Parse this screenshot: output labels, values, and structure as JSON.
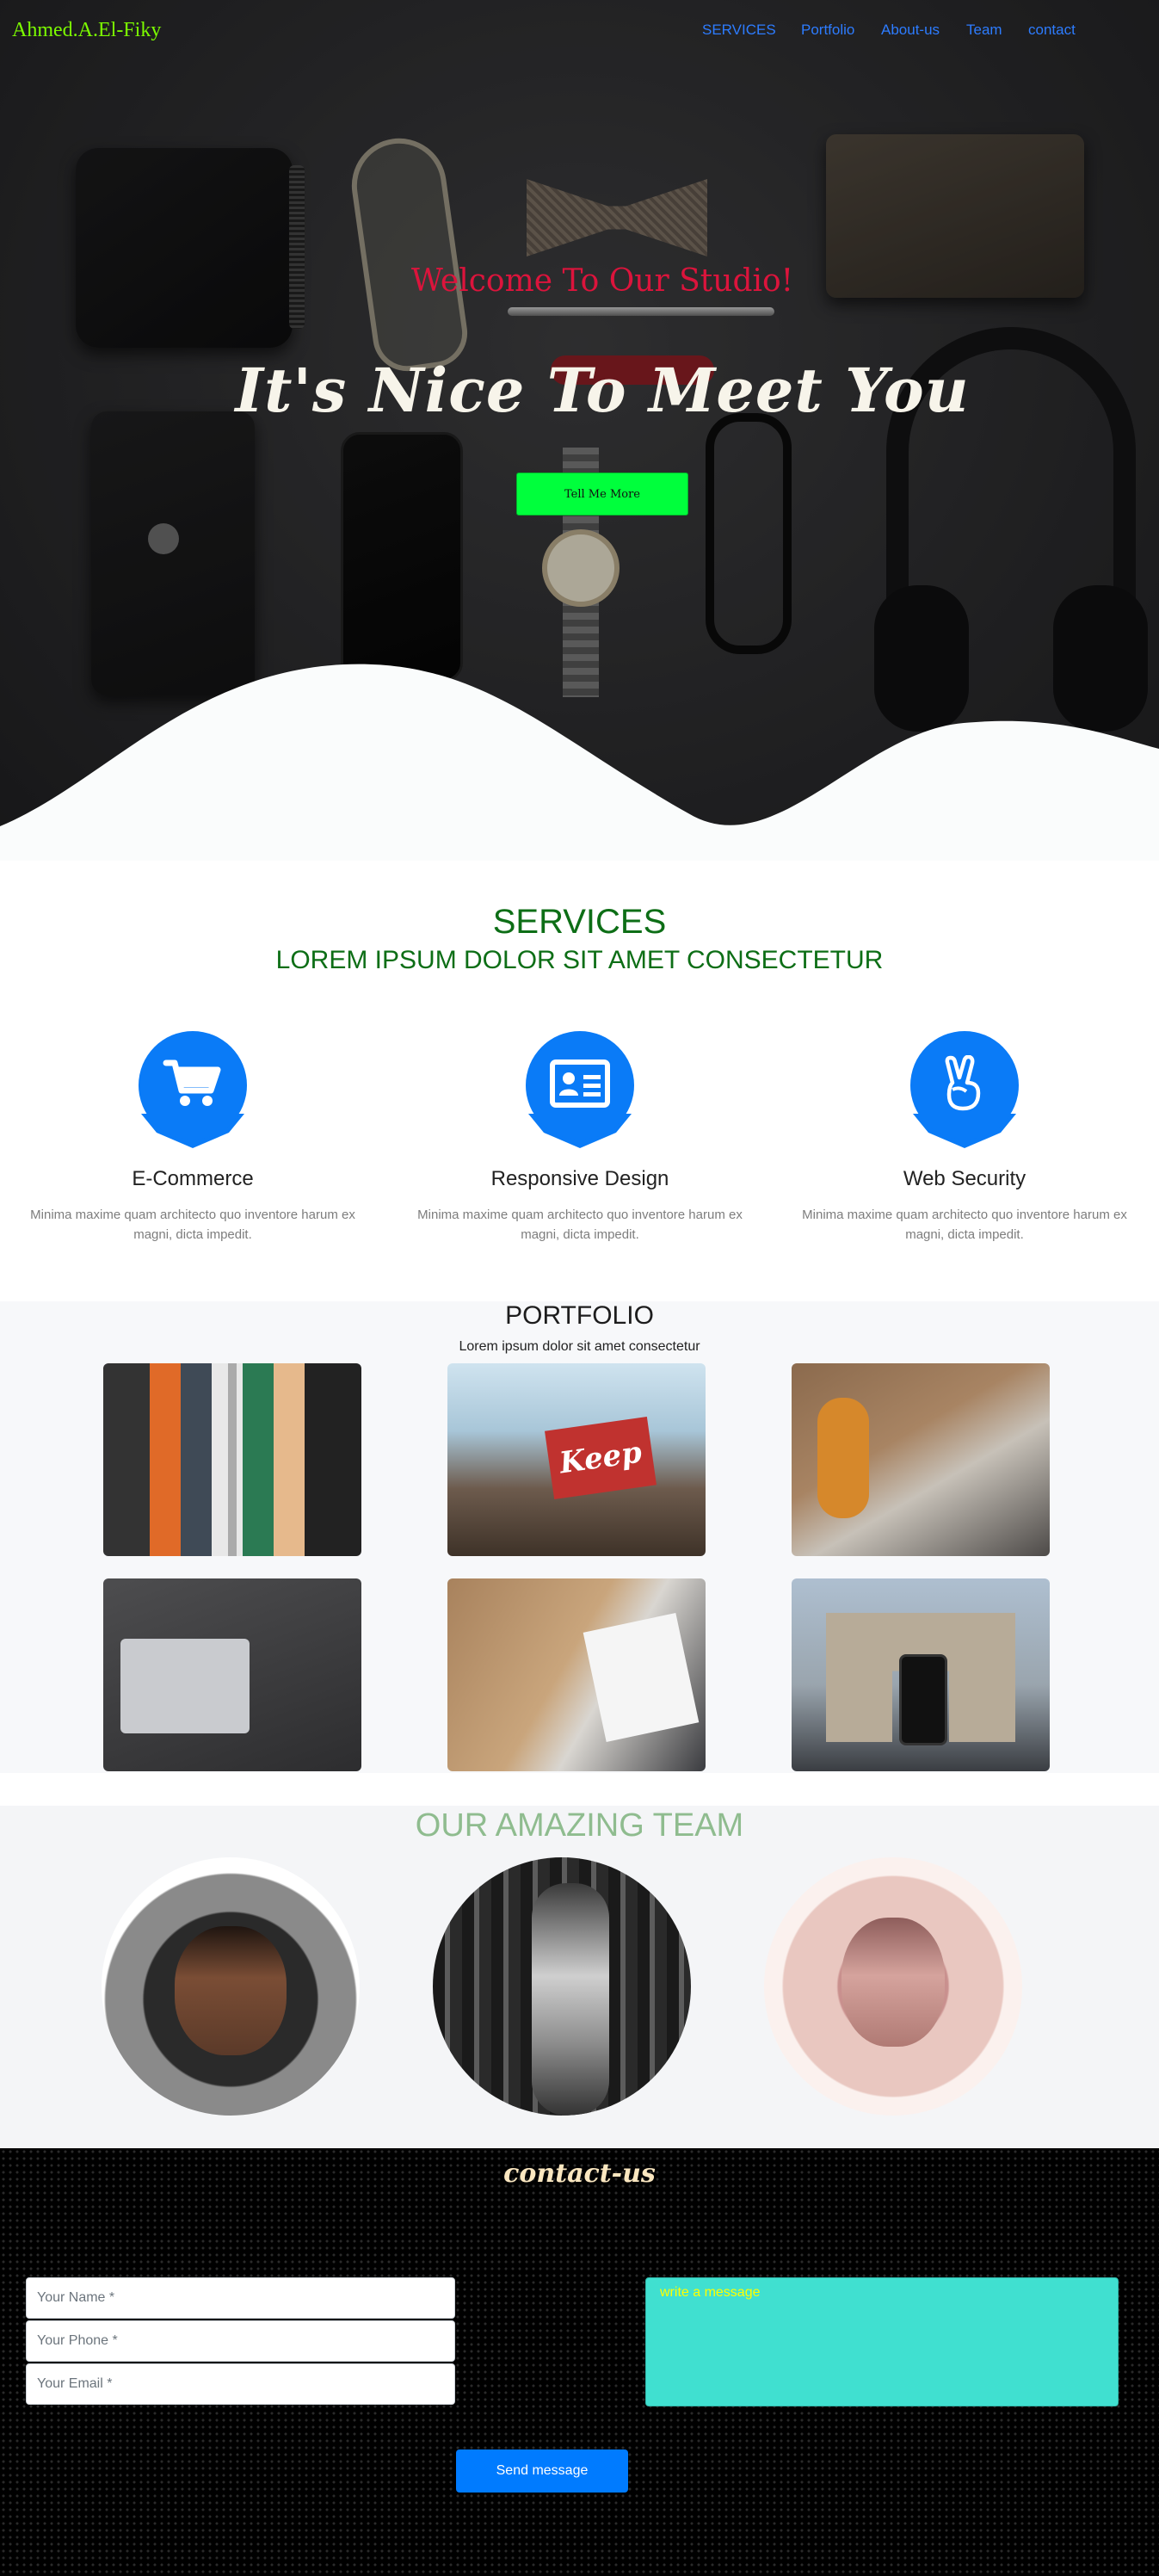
{
  "navbar": {
    "brand": "Ahmed.A.El-Fiky",
    "links": [
      "SERVICES",
      "Portfolio",
      "About-us",
      "Team",
      "contact"
    ]
  },
  "hero": {
    "welcome": "Welcome To Our Studio!",
    "headline": "It's Nice To Meet You",
    "button_label": "Tell Me More"
  },
  "services": {
    "title": "SERVICES",
    "subtitle": "LOREM IPSUM DOLOR SIT AMET CONSECTETUR",
    "items": [
      {
        "name": "E-Commerce",
        "icon": "shopping-cart-icon",
        "description": "Minima maxime quam architecto quo inventore harum ex magni, dicta impedit."
      },
      {
        "name": "Responsive Design",
        "icon": "id-card-icon",
        "description": "Minima maxime quam architecto quo inventore harum ex magni, dicta impedit."
      },
      {
        "name": "Web Security",
        "icon": "peace-hand-icon",
        "description": "Minima maxime quam architecto quo inventore harum ex magni, dicta impedit."
      }
    ]
  },
  "portfolio": {
    "title": "PORTFOLIO",
    "subtitle": "Lorem ipsum dolor sit amet consectetur"
  },
  "team": {
    "title": "OUR AMAZING TEAM"
  },
  "contact": {
    "title": "contact-us",
    "name_placeholder": "Your Name *",
    "phone_placeholder": "Your Phone *",
    "email_placeholder": "Your Email *",
    "message_placeholder": "write a message",
    "send_label": "Send message"
  },
  "colors": {
    "brand": "#7cfc00",
    "nav_link": "#2d7cff",
    "welcome": "#dc143c",
    "hero_button": "#00ff3c",
    "services_heading": "#0d6e16",
    "service_icon": "#0a7bf7",
    "team_heading": "#8fbc8f",
    "message_box": "#40e0d0",
    "send_button": "#007bff"
  }
}
